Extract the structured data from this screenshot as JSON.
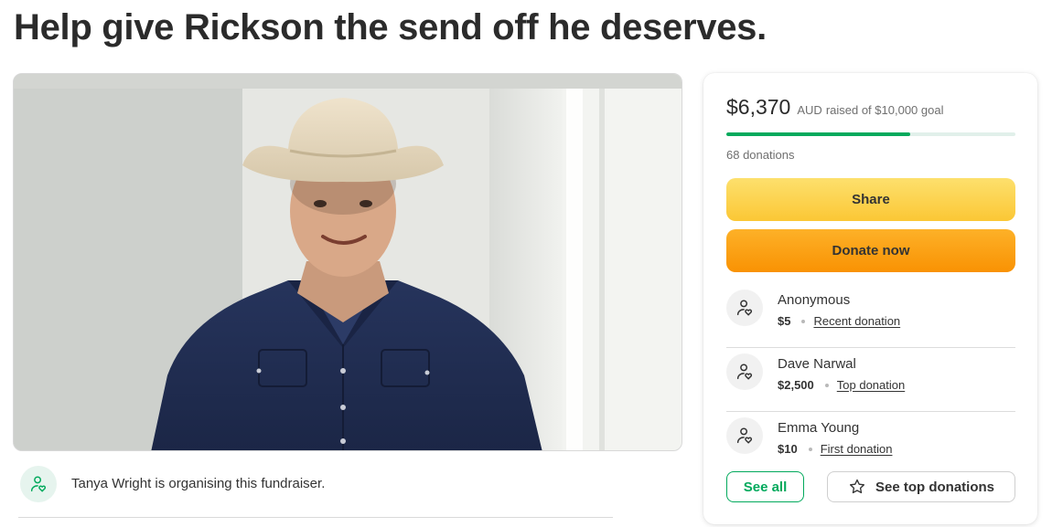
{
  "campaign": {
    "title": "Help give Rickson the send off he deserves.",
    "photo_alt": "Rickson in a cowboy hat"
  },
  "organiser": {
    "text": "Tanya Wright is organising this fundraiser.",
    "avatar_icon": "heart-hand-icon"
  },
  "progress": {
    "raised": "$6,370",
    "currency": "AUD",
    "goal_text": "raised of $10,000 goal",
    "fraction": 0.637,
    "donations_text": "68 donations"
  },
  "buttons": {
    "share": "Share",
    "donate": "Donate now",
    "see_all": "See all",
    "see_top": "See top donations"
  },
  "donations": [
    {
      "name": "Anonymous",
      "amount": "$5",
      "tag": "Recent donation"
    },
    {
      "name": "Dave Narwal",
      "amount": "$2,500",
      "tag": "Top donation"
    },
    {
      "name": "Emma Young",
      "amount": "$10",
      "tag": "First donation"
    }
  ],
  "colors": {
    "brand_green": "#02a95c",
    "share_yellow": "#fbc735",
    "donate_orange": "#f99203"
  }
}
